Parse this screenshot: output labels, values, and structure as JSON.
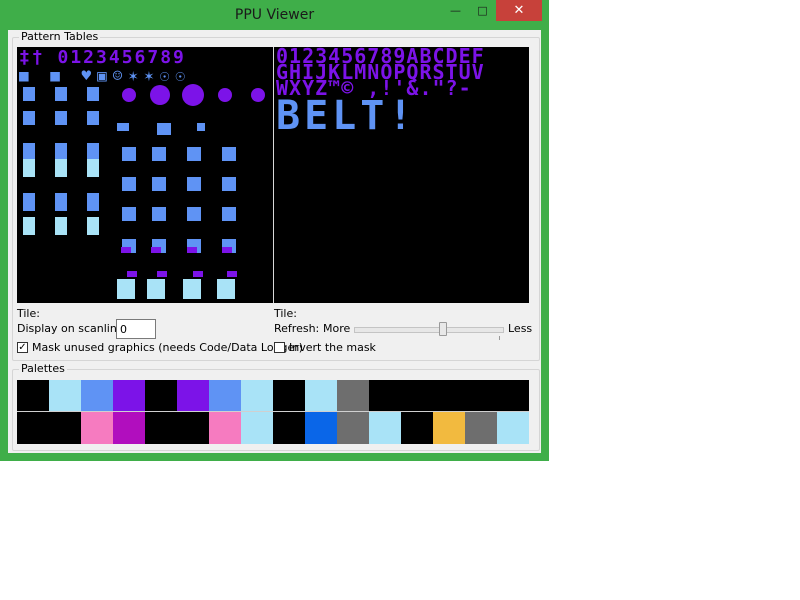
{
  "window": {
    "title": "PPU Viewer",
    "minimize_glyph": "—",
    "maximize_glyph": "□",
    "close_glyph": "✕"
  },
  "pattern_tables": {
    "group_label": "Pattern Tables",
    "right_rows": [
      "0123456789ABCDEF",
      "GHIJKLMNOPQRSTUV",
      "WXYZ™© ,!'&.\"?-",
      "BELT!"
    ],
    "left_rows": [
      "‡† 0123456789",
      "■ ■ ♥▣☺✶✶☉☉"
    ],
    "left_tile_label": "Tile:",
    "right_tile_label": "Tile:",
    "scanline_label": "Display on scanline:",
    "scanline_value": "0",
    "refresh_label": "Refresh:",
    "refresh_more": "More",
    "refresh_less": "Less",
    "refresh_level": 0.6,
    "mask_label": "Mask unused graphics (needs Code/Data Logger)",
    "mask_checked": true,
    "invert_label": "Invert the mask",
    "invert_checked": false
  },
  "palettes": {
    "group_label": "Palettes",
    "row1": [
      "#000000",
      "#a9e3f7",
      "#5f93f4",
      "#7c13e8",
      "#000000",
      "#7c13e8",
      "#5f93f4",
      "#a9e3f7",
      "#000000",
      "#a9e3f7",
      "#6e6e6e",
      "#000000",
      "#000000",
      "#000000",
      "#000000",
      "#000000"
    ],
    "row2": [
      "#000000",
      "#000000",
      "#f67bc0",
      "#b10ebe",
      "#000000",
      "#000000",
      "#f67bc0",
      "#a9e3f7",
      "#000000",
      "#0a66e8",
      "#6e6e6e",
      "#a9e3f7",
      "#000000",
      "#f2ba3f",
      "#6e6e6e",
      "#a9e3f7"
    ]
  },
  "colors": {
    "title_bar": "#3fae49",
    "close_button": "#c7413a",
    "sprite_blue": "#5f93f4",
    "sprite_purple": "#7c13e8",
    "sprite_light": "#a9e3f7"
  }
}
